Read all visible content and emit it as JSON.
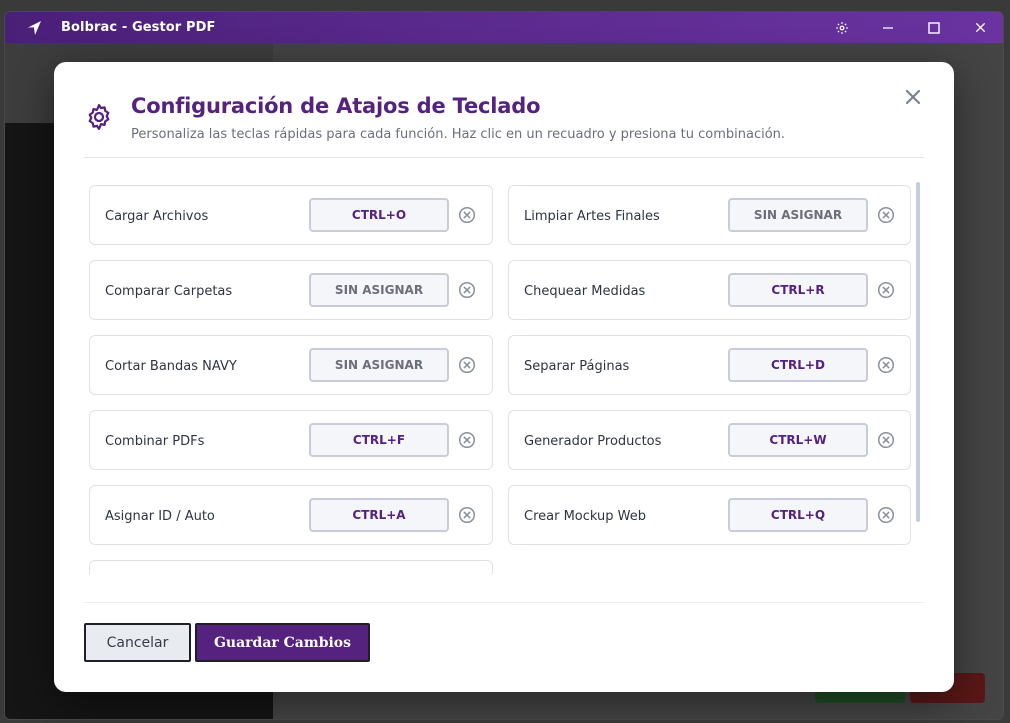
{
  "window": {
    "title": "Bolbrac - Gestor PDF",
    "accent_color": "#55227f"
  },
  "titlebar_controls": [
    {
      "name": "settings",
      "glyph": "⚙"
    },
    {
      "name": "minimize",
      "glyph": "—"
    },
    {
      "name": "maximize",
      "glyph": "☐"
    },
    {
      "name": "close",
      "glyph": "✕"
    }
  ],
  "modal": {
    "title": "Configuración de Atajos de Teclado",
    "subtitle": "Personaliza las teclas rápidas para cada función. Haz clic en un recuadro y presiona tu combinación.",
    "shortcuts": [
      {
        "label": "Cargar Archivos",
        "key": "CTRL+O",
        "assigned": true
      },
      {
        "label": "Limpiar Artes Finales",
        "key": "SIN ASIGNAR",
        "assigned": false
      },
      {
        "label": "Comparar Carpetas",
        "key": "SIN ASIGNAR",
        "assigned": false
      },
      {
        "label": "Chequear Medidas",
        "key": "CTRL+R",
        "assigned": true
      },
      {
        "label": "Cortar Bandas NAVY",
        "key": "SIN ASIGNAR",
        "assigned": false
      },
      {
        "label": "Separar Páginas",
        "key": "CTRL+D",
        "assigned": true
      },
      {
        "label": "Combinar PDFs",
        "key": "CTRL+F",
        "assigned": true
      },
      {
        "label": "Generador Productos",
        "key": "CTRL+W",
        "assigned": true
      },
      {
        "label": "Asignar ID / Auto",
        "key": "CTRL+A",
        "assigned": true
      },
      {
        "label": "Crear Mockup Web",
        "key": "CTRL+Q",
        "assigned": true
      }
    ],
    "cancel_label": "Cancelar",
    "save_label": "Guardar Cambios"
  }
}
